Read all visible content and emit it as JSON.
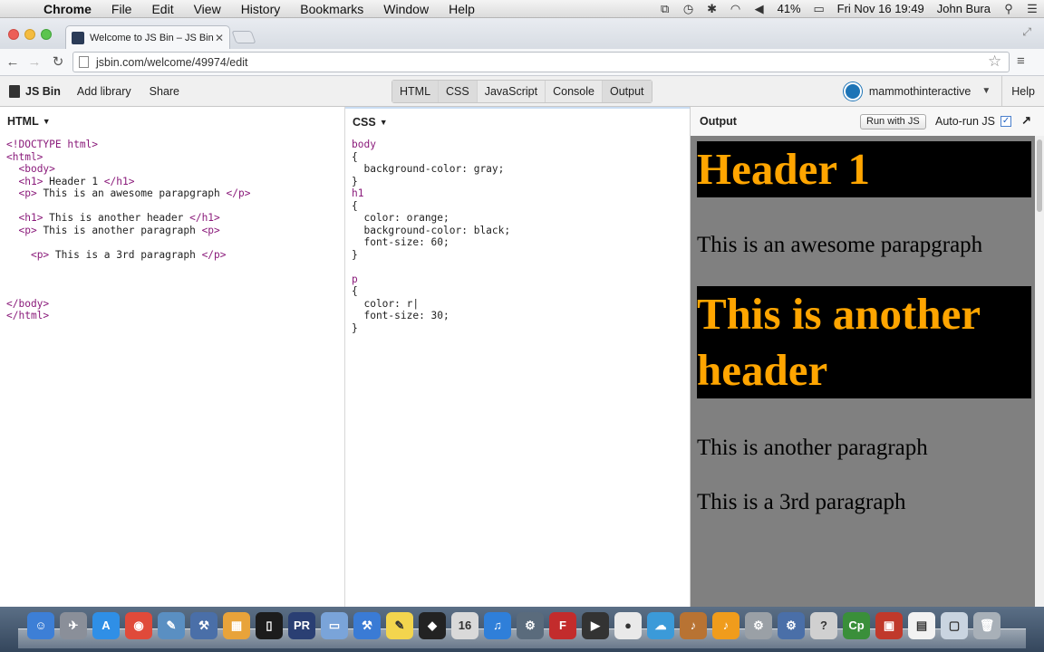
{
  "menubar": {
    "app": "Chrome",
    "items": [
      "File",
      "Edit",
      "View",
      "History",
      "Bookmarks",
      "Window",
      "Help"
    ],
    "battery": "41%",
    "datetime": "Fri Nov 16  19:49",
    "user": "John Bura"
  },
  "browser": {
    "tab_title": "Welcome to JS Bin – JS Bin",
    "url": "jsbin.com/welcome/49974/edit"
  },
  "jsbin": {
    "logo": "JS Bin",
    "add_library": "Add library",
    "share": "Share",
    "panels": [
      "HTML",
      "CSS",
      "JavaScript",
      "Console",
      "Output"
    ],
    "username": "mammothinteractive",
    "help": "Help"
  },
  "html_panel": {
    "label": "HTML",
    "lines": [
      "<!DOCTYPE html>",
      "<html>",
      "  <body>",
      "  <h1> Header 1 </h1>",
      "  <p> This is an awesome parapgraph </p>",
      "",
      "  <h1> This is another header </h1>",
      "  <p> This is another paragraph <p>",
      "",
      "    <p> This is a 3rd paragraph </p>",
      "",
      "",
      "",
      "</body>",
      "</html>"
    ]
  },
  "css_panel": {
    "label": "CSS",
    "lines": [
      "body",
      "{",
      "  background-color: gray;",
      "}",
      "h1",
      "{",
      "  color: orange;",
      "  background-color: black;",
      "  font-size: 60;",
      "}",
      "",
      "p",
      "{",
      "  color: r|",
      "  font-size: 30;",
      "}"
    ]
  },
  "output_panel": {
    "label": "Output",
    "run_button": "Run with JS",
    "autorun": "Auto-run JS",
    "h1_first": "Header 1",
    "p_first": "This is an awesome parapgraph",
    "h1_second": "This is another header",
    "p_second": "This is another paragraph",
    "p_third": "This is a 3rd paragraph"
  },
  "colors": {
    "h1_text": "#ffa500",
    "h1_bg": "#000000",
    "output_bg": "#808080"
  },
  "dock": {
    "icons": [
      "finder-icon",
      "launchpad-icon",
      "app-store-icon",
      "chrome-icon",
      "preview-icon",
      "xcode-icon",
      "keynote-icon",
      "ios-simulator-icon",
      "premiere-icon",
      "folder-icon",
      "xcode-alt-icon",
      "notes-icon",
      "unity-icon",
      "ical-icon",
      "itunes-icon",
      "tools-icon",
      "flash-icon",
      "final-cut-icon",
      "dvd-icon",
      "cloud-icon",
      "garageband-icon",
      "fl-studio-icon",
      "settings-icon",
      "compressor-icon",
      "help-icon",
      "captivate-icon",
      "cue-icon",
      "documents-icon",
      "downloads-icon",
      "trash-icon"
    ]
  }
}
